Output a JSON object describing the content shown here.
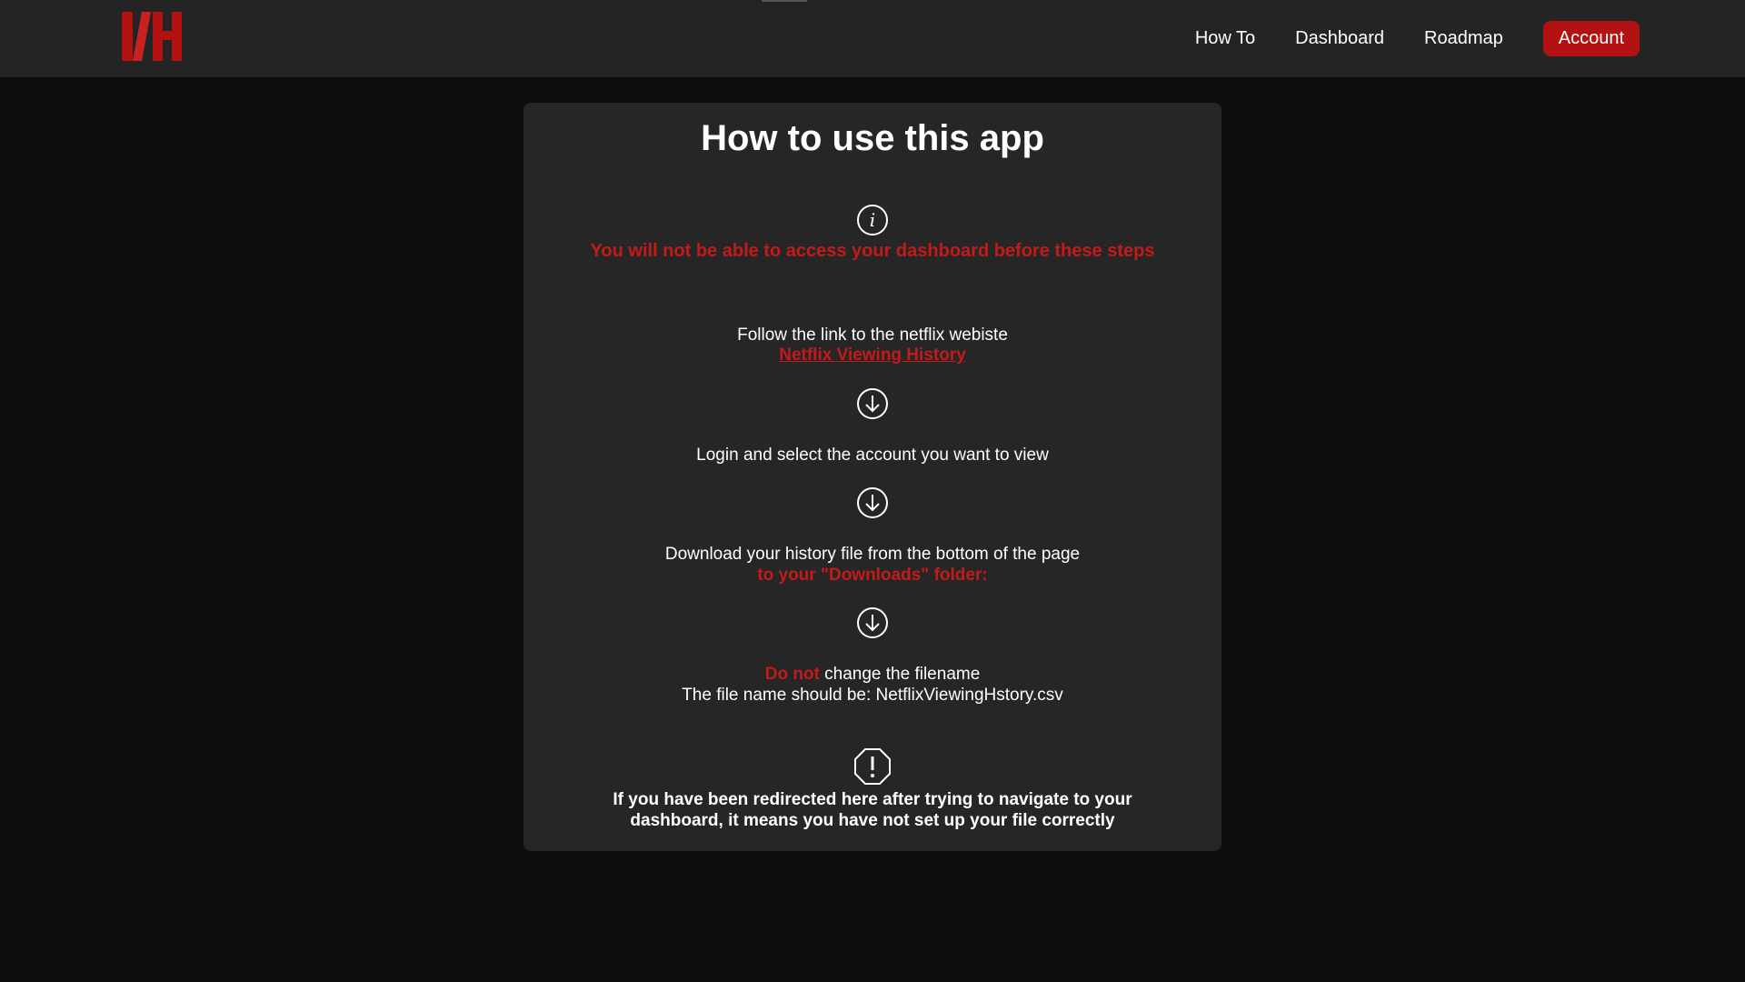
{
  "nav": {
    "logo_text": "NH",
    "links": [
      "How To",
      "Dashboard",
      "Roadmap"
    ],
    "account_label": "Account",
    "accent_color": "#b31212"
  },
  "main": {
    "title": "How to use this app",
    "info_icon": "info-circle-icon",
    "warning": "You will not be able to access your dashboard before these steps",
    "step1": {
      "text": "Follow the link to the netflix webiste",
      "link_text": "Netflix Viewing History"
    },
    "step2": {
      "text": "Login and select the account you want to view"
    },
    "step3": {
      "text": "Download your history file from the bottom of the page",
      "highlight": "to your \"Downloads\" folder:"
    },
    "step4": {
      "prefix": "Do not",
      "rest": " change the filename",
      "filename_line": "The file name should be: NetflixViewingHstory.csv"
    },
    "arrow_icon": "arrow-down-circle-icon",
    "alert_icon": "exclamation-octagon-icon",
    "notice": "If you have been redirected here after trying to navigate to your dashboard, it means you have not set up your file correctly"
  }
}
